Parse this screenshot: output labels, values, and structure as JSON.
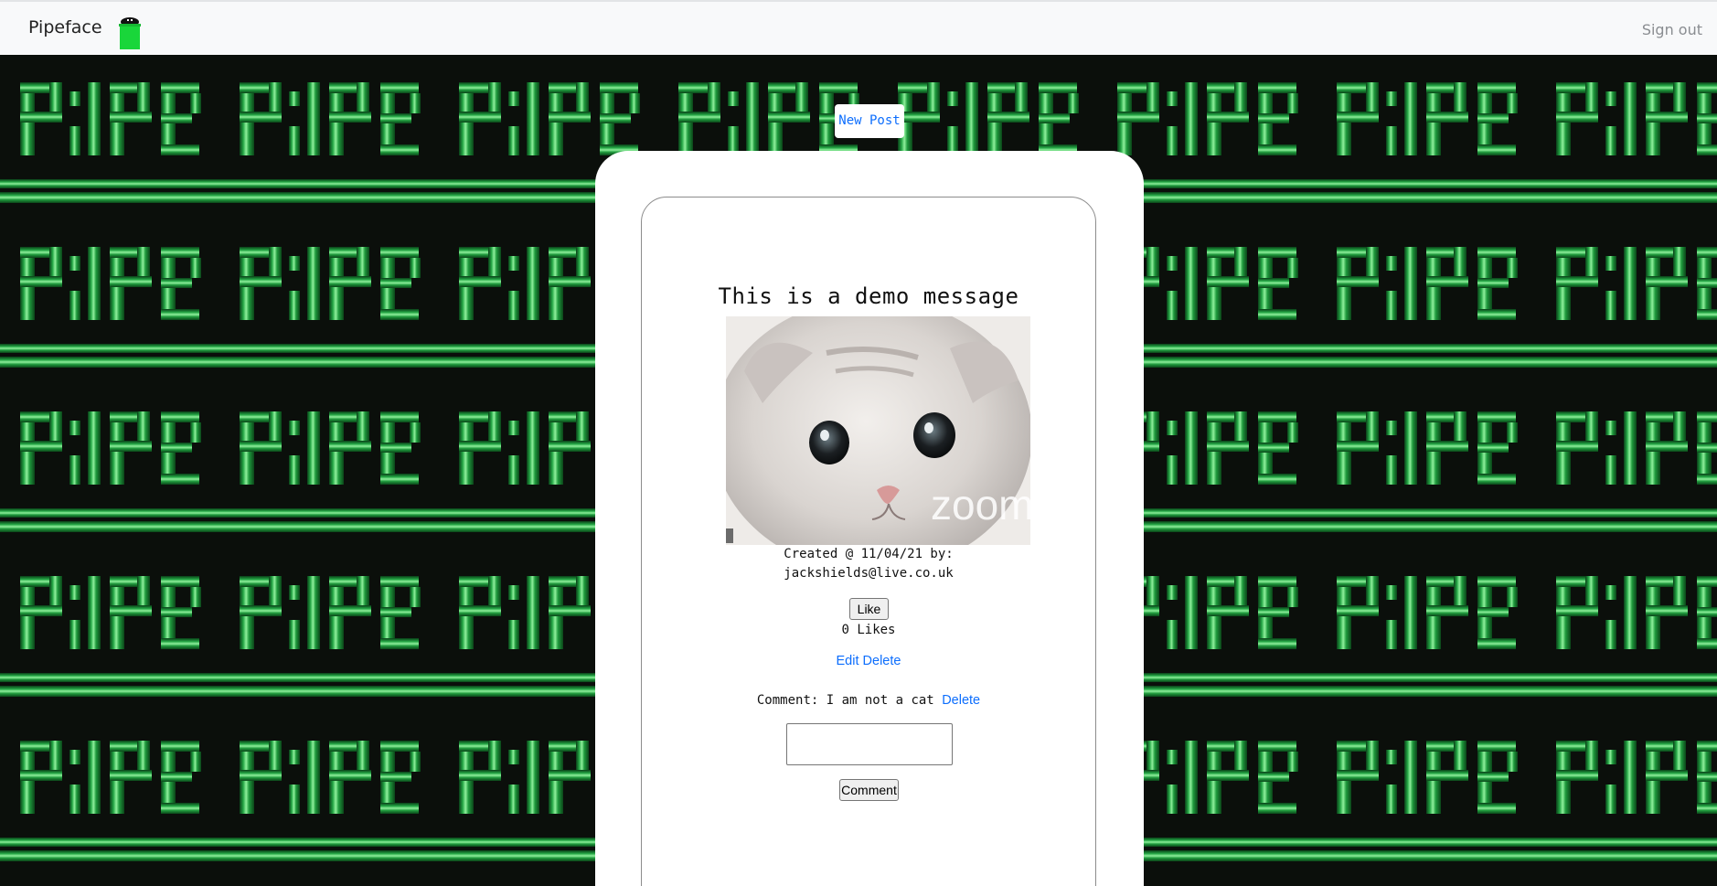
{
  "navbar": {
    "brand": "Pipeface",
    "logo_icon": "green-pipe-logo-icon",
    "signout_label": "Sign out"
  },
  "background": {
    "pattern": "green-pipes",
    "colors": {
      "pipe_dark": "#0f5a24",
      "pipe_mid": "#1f9a3d",
      "pipe_light": "#5fe27a",
      "backdrop": "#0b0f0b"
    }
  },
  "actions": {
    "new_post_label": "New Post"
  },
  "post": {
    "message": "This is a demo message",
    "image_alt": "cat face with zoom filter",
    "image_watermark": "zoom",
    "meta_line1": "Created @ 11/04/21 by:",
    "meta_line2": "jackshields@live.co.uk",
    "like_label": "Like",
    "likes_text": "0 Likes",
    "edit_label": "Edit",
    "delete_label": "Delete",
    "comment": {
      "prefix": "Comment: I am not a cat",
      "delete_label": "Delete"
    },
    "comment_input_value": "",
    "comment_button_label": "Comment"
  },
  "colors": {
    "link": "#0d6efd",
    "navbar_bg": "#f8f9fa",
    "panel_bg": "#ffffff"
  }
}
